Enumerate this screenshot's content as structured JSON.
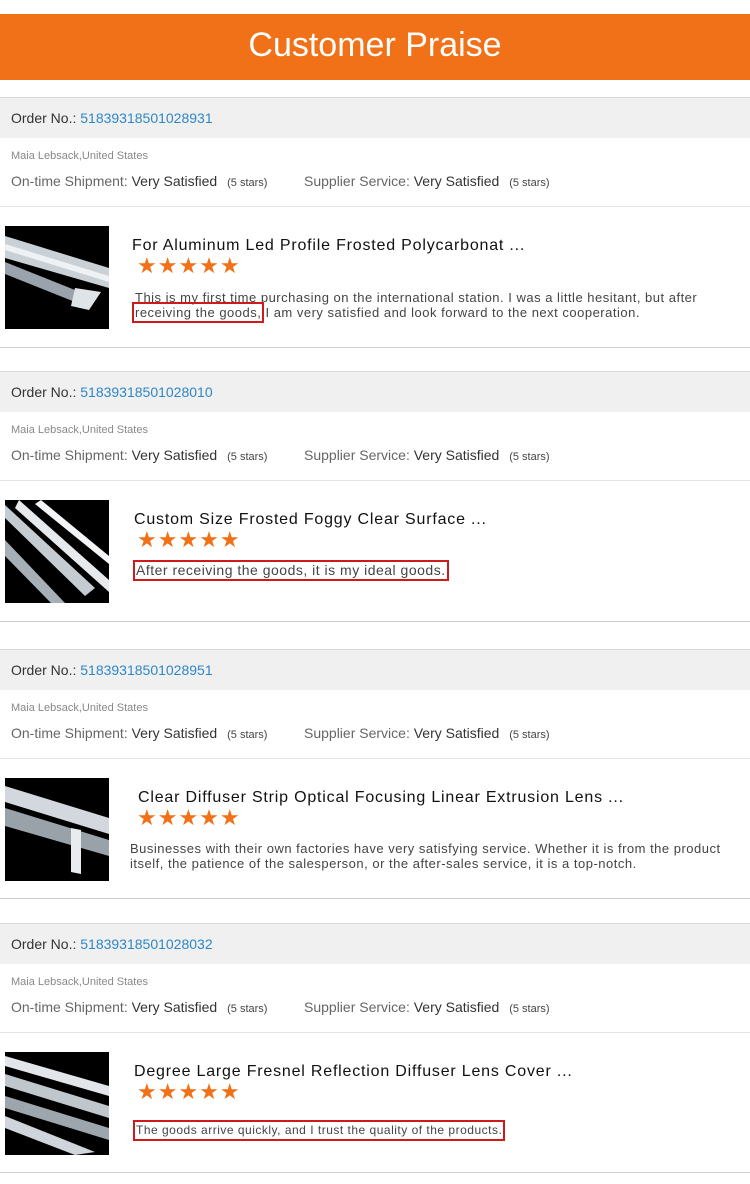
{
  "header": {
    "title": "Customer Praise"
  },
  "labels": {
    "order_no": "Order No.:",
    "ontime": "On-time Shipment:",
    "supplier": "Supplier Service:"
  },
  "reviews": [
    {
      "order_number": "51839318501028931",
      "buyer": "Maia Lebsack,United States",
      "ontime_value": "Very Satisfied",
      "ontime_stars": "(5 stars)",
      "supplier_value": "Very Satisfied",
      "supplier_stars": "(5 stars)",
      "product_title": "For Aluminum Led Profile Frosted Polycarbonat ...",
      "rating": 5,
      "comment_before": "This is my first time purchasing on the international station. I was a little hesitant, but after ",
      "comment_highlight": "receiving the goods,",
      "comment_after": " I am very satisfied and look forward to the next cooperation."
    },
    {
      "order_number": "51839318501028010",
      "buyer": "Maia Lebsack,United States",
      "ontime_value": "Very Satisfied",
      "ontime_stars": "(5 stars)",
      "supplier_value": "Very Satisfied",
      "supplier_stars": "(5 stars)",
      "product_title": "Custom Size Frosted Foggy Clear Surface ...",
      "rating": 5,
      "comment": "After receiving the goods, it is my ideal goods."
    },
    {
      "order_number": "51839318501028951",
      "buyer": "Maia Lebsack,United States",
      "ontime_value": "Very Satisfied",
      "ontime_stars": "(5 stars)",
      "supplier_value": "Very Satisfied",
      "supplier_stars": "(5 stars)",
      "product_title": "Clear Diffuser Strip Optical Focusing Linear Extrusion Lens ...",
      "rating": 5,
      "comment": "Businesses with their own factories have very satisfying service. Whether it is from the product itself, the patience of the salesperson, or the after-sales service, it is a top-notch."
    },
    {
      "order_number": "51839318501028032",
      "buyer": "Maia Lebsack,United States",
      "ontime_value": "Very Satisfied",
      "ontime_stars": "(5 stars)",
      "supplier_value": "Very Satisfied",
      "supplier_stars": "(5 stars)",
      "product_title": "Degree Large Fresnel Reflection Diffuser Lens Cover ...",
      "rating": 5,
      "comment": "The goods arrive quickly, and I trust the quality of the products."
    }
  ],
  "colors": {
    "accent": "#f07118",
    "link": "#2e86c8",
    "highlight_box": "#d01a1a"
  }
}
